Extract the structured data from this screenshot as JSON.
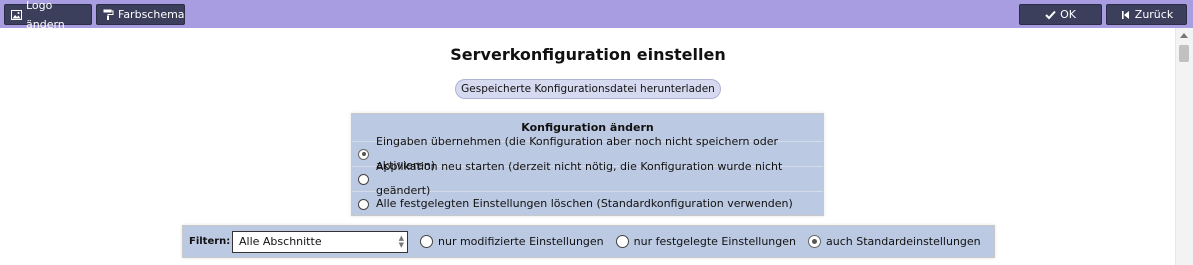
{
  "toolbar": {
    "logo_label": "Logo ändern",
    "color_label": "Farbschema",
    "ok_label": "OK",
    "back_label": "Zurück",
    "bar_color": "#a89de0",
    "button_color": "#3b3f5c"
  },
  "page": {
    "title": "Serverkonfiguration einstellen",
    "download_label": "Gespeicherte Konfigurationsdatei herunterladen"
  },
  "config_panel": {
    "heading": "Konfiguration ändern",
    "options": [
      {
        "label": "Eingaben übernehmen (die Konfiguration aber noch nicht speichern oder aktivieren)",
        "selected": true
      },
      {
        "label": "Applikation neu starten (derzeit nicht nötig, die Konfiguration wurde nicht geändert)",
        "selected": false
      },
      {
        "label": "Alle festgelegten Einstellungen löschen (Standardkonfiguration verwenden)",
        "selected": false
      }
    ],
    "background": "#bcc9e2"
  },
  "filter": {
    "label": "Filtern:",
    "section_value": "Alle Abschnitte",
    "options": [
      {
        "label": "nur modifizierte Einstellungen",
        "selected": false
      },
      {
        "label": "nur festgelegte Einstellungen",
        "selected": false
      },
      {
        "label": "auch Standardeinstellungen",
        "selected": true
      }
    ]
  }
}
